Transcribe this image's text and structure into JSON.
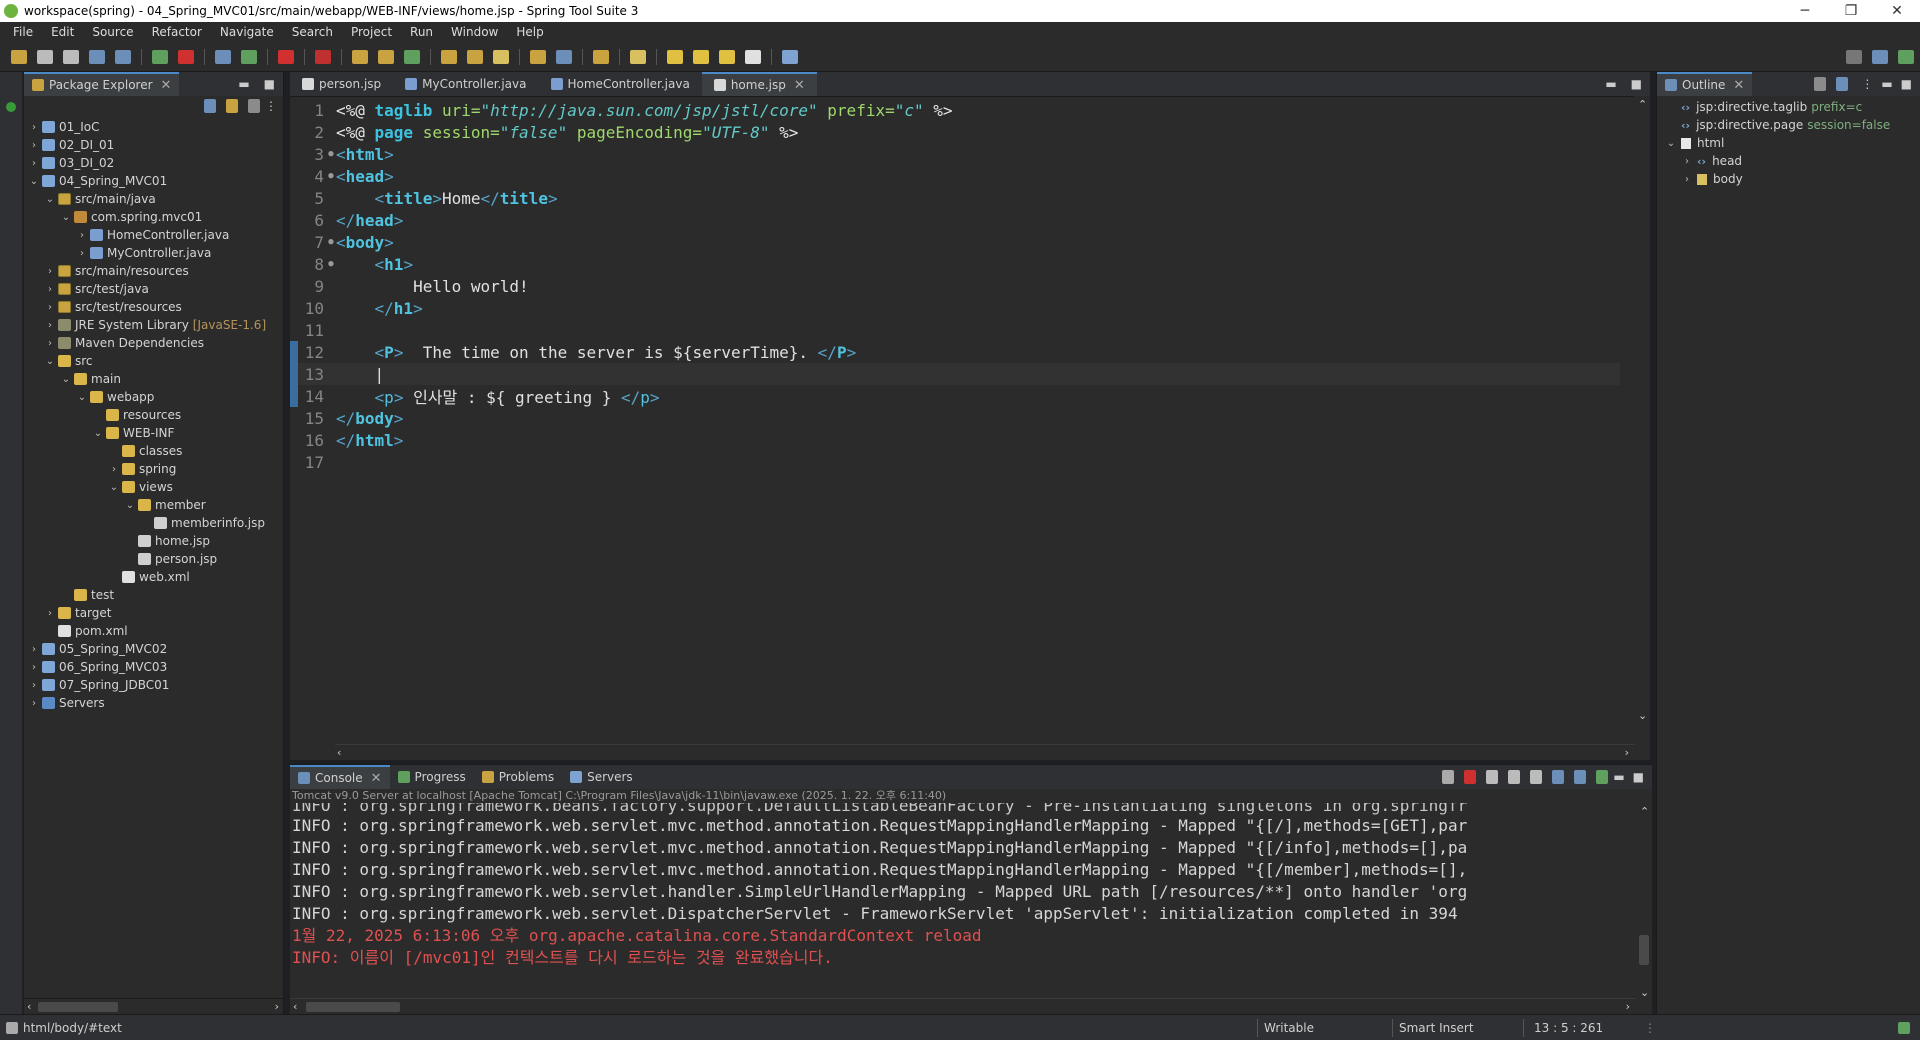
{
  "window": {
    "title": "workspace(spring) - 04_Spring_MVC01/src/main/webapp/WEB-INF/views/home.jsp - Spring Tool Suite 3",
    "minimize": "─",
    "restore": "❐",
    "close": "✕"
  },
  "menu": [
    "File",
    "Edit",
    "Source",
    "Refactor",
    "Navigate",
    "Search",
    "Project",
    "Run",
    "Window",
    "Help"
  ],
  "package_explorer": {
    "title": "Package Explorer",
    "tree": [
      {
        "label": "01_IoC",
        "icon": "project",
        "indent": 0,
        "tw": "›"
      },
      {
        "label": "02_DI_01",
        "icon": "project",
        "indent": 0,
        "tw": "›"
      },
      {
        "label": "03_DI_02",
        "icon": "project",
        "indent": 0,
        "tw": "›"
      },
      {
        "label": "04_Spring_MVC01",
        "icon": "project",
        "indent": 0,
        "tw": "⌄"
      },
      {
        "label": "src/main/java",
        "icon": "srcfolder",
        "indent": 1,
        "tw": "⌄"
      },
      {
        "label": "com.spring.mvc01",
        "icon": "package",
        "indent": 2,
        "tw": "⌄"
      },
      {
        "label": "HomeController.java",
        "icon": "java",
        "indent": 3,
        "tw": "›"
      },
      {
        "label": "MyController.java",
        "icon": "java",
        "indent": 3,
        "tw": "›"
      },
      {
        "label": "src/main/resources",
        "icon": "srcfolder",
        "indent": 1,
        "tw": "›"
      },
      {
        "label": "src/test/java",
        "icon": "srcfolder",
        "indent": 1,
        "tw": "›"
      },
      {
        "label": "src/test/resources",
        "icon": "srcfolder",
        "indent": 1,
        "tw": "›"
      },
      {
        "label": "JRE System Library",
        "icon": "jar",
        "indent": 1,
        "tw": "›",
        "decor": "[JavaSE-1.6]"
      },
      {
        "label": "Maven Dependencies",
        "icon": "jar",
        "indent": 1,
        "tw": "›"
      },
      {
        "label": "src",
        "icon": "folder",
        "indent": 1,
        "tw": "⌄"
      },
      {
        "label": "main",
        "icon": "folder",
        "indent": 2,
        "tw": "⌄"
      },
      {
        "label": "webapp",
        "icon": "folder",
        "indent": 3,
        "tw": "⌄"
      },
      {
        "label": "resources",
        "icon": "folder",
        "indent": 4,
        "tw": ""
      },
      {
        "label": "WEB-INF",
        "icon": "folder",
        "indent": 4,
        "tw": "⌄"
      },
      {
        "label": "classes",
        "icon": "folder",
        "indent": 5,
        "tw": ""
      },
      {
        "label": "spring",
        "icon": "folder",
        "indent": 5,
        "tw": "›"
      },
      {
        "label": "views",
        "icon": "folder",
        "indent": 5,
        "tw": "⌄"
      },
      {
        "label": "member",
        "icon": "folder",
        "indent": 6,
        "tw": "⌄"
      },
      {
        "label": "memberinfo.jsp",
        "icon": "file",
        "indent": 7,
        "tw": ""
      },
      {
        "label": "home.jsp",
        "icon": "file",
        "indent": 6,
        "tw": ""
      },
      {
        "label": "person.jsp",
        "icon": "file",
        "indent": 6,
        "tw": ""
      },
      {
        "label": "web.xml",
        "icon": "xml",
        "indent": 5,
        "tw": ""
      },
      {
        "label": "test",
        "icon": "folder",
        "indent": 2,
        "tw": ""
      },
      {
        "label": "target",
        "icon": "folder",
        "indent": 1,
        "tw": "›"
      },
      {
        "label": "pom.xml",
        "icon": "xml",
        "indent": 1,
        "tw": ""
      },
      {
        "label": "05_Spring_MVC02",
        "icon": "project",
        "indent": 0,
        "tw": "›"
      },
      {
        "label": "06_Spring_MVC03",
        "icon": "project",
        "indent": 0,
        "tw": "›"
      },
      {
        "label": "07_Spring_JDBC01",
        "icon": "project",
        "indent": 0,
        "tw": "›"
      },
      {
        "label": "Servers",
        "icon": "server",
        "indent": 0,
        "tw": "›"
      }
    ]
  },
  "editor": {
    "tabs": [
      {
        "label": "person.jsp",
        "active": false
      },
      {
        "label": "MyController.java",
        "active": false
      },
      {
        "label": "HomeController.java",
        "active": false
      },
      {
        "label": "home.jsp",
        "active": true
      }
    ],
    "current_line": 13,
    "lines": [
      {
        "n": "1",
        "fold": "",
        "tokens": [
          [
            "t-dir",
            "<%@ "
          ],
          [
            "t-kw",
            "taglib"
          ],
          [
            "t-attr",
            " uri="
          ],
          [
            "t-str",
            "\"http://java.sun.com/jsp/jstl/core\""
          ],
          [
            "t-attr",
            " prefix="
          ],
          [
            "t-str",
            "\"c\""
          ],
          [
            "t-dir",
            " %>"
          ]
        ]
      },
      {
        "n": "2",
        "fold": "",
        "tokens": [
          [
            "t-dir",
            "<%@ "
          ],
          [
            "t-kw",
            "page"
          ],
          [
            "t-attr",
            " session="
          ],
          [
            "t-str",
            "\"false\""
          ],
          [
            "t-attr",
            " pageEncoding="
          ],
          [
            "t-str",
            "\"UTF-8\""
          ],
          [
            "t-dir",
            " %>"
          ]
        ]
      },
      {
        "n": "3",
        "fold": "●",
        "tokens": [
          [
            "t-brk",
            "<"
          ],
          [
            "t-tag",
            "html"
          ],
          [
            "t-brk",
            ">"
          ]
        ]
      },
      {
        "n": "4",
        "fold": "●",
        "tokens": [
          [
            "t-brk",
            "<"
          ],
          [
            "t-tag",
            "head"
          ],
          [
            "t-brk",
            ">"
          ]
        ]
      },
      {
        "n": "5",
        "fold": "",
        "tokens": [
          [
            "t-text",
            "    "
          ],
          [
            "t-brk",
            "<"
          ],
          [
            "t-tag",
            "title"
          ],
          [
            "t-brk",
            ">"
          ],
          [
            "t-text",
            "Home"
          ],
          [
            "t-brk",
            "</"
          ],
          [
            "t-tag",
            "title"
          ],
          [
            "t-brk",
            ">"
          ]
        ]
      },
      {
        "n": "6",
        "fold": "",
        "tokens": [
          [
            "t-brk",
            "</"
          ],
          [
            "t-tag",
            "head"
          ],
          [
            "t-brk",
            ">"
          ]
        ]
      },
      {
        "n": "7",
        "fold": "●",
        "tokens": [
          [
            "t-brk",
            "<"
          ],
          [
            "t-tag",
            "body"
          ],
          [
            "t-brk",
            ">"
          ]
        ]
      },
      {
        "n": "8",
        "fold": "●",
        "tokens": [
          [
            "t-text",
            "    "
          ],
          [
            "t-brk",
            "<"
          ],
          [
            "t-tag",
            "h1"
          ],
          [
            "t-brk",
            ">"
          ]
        ]
      },
      {
        "n": "9",
        "fold": "",
        "tokens": [
          [
            "t-text",
            "        Hello world!"
          ]
        ]
      },
      {
        "n": "10",
        "fold": "",
        "tokens": [
          [
            "t-text",
            "    "
          ],
          [
            "t-brk",
            "</"
          ],
          [
            "t-tag",
            "h1"
          ],
          [
            "t-brk",
            ">"
          ]
        ]
      },
      {
        "n": "11",
        "fold": "",
        "tokens": []
      },
      {
        "n": "12",
        "fold": "",
        "tokens": [
          [
            "t-text",
            "    "
          ],
          [
            "t-brk",
            "<"
          ],
          [
            "t-tag",
            "P"
          ],
          [
            "t-brk",
            ">"
          ],
          [
            "t-text",
            "  The time on the server is ${serverTime}. "
          ],
          [
            "t-brk",
            "</"
          ],
          [
            "t-tag",
            "P"
          ],
          [
            "t-brk",
            ">"
          ]
        ]
      },
      {
        "n": "13",
        "fold": "",
        "tokens": [
          [
            "t-text",
            "    |"
          ]
        ]
      },
      {
        "n": "14",
        "fold": "",
        "tokens": [
          [
            "t-text",
            "    "
          ],
          [
            "t-brk",
            "<"
          ],
          [
            "t-tagp",
            "p"
          ],
          [
            "t-brk",
            ">"
          ],
          [
            "t-text",
            " 인사말 : ${ greeting } "
          ],
          [
            "t-brk",
            "</"
          ],
          [
            "t-tagp",
            "p"
          ],
          [
            "t-brk",
            ">"
          ]
        ]
      },
      {
        "n": "15",
        "fold": "",
        "tokens": [
          [
            "t-brk",
            "</"
          ],
          [
            "t-tag",
            "body"
          ],
          [
            "t-brk",
            ">"
          ]
        ]
      },
      {
        "n": "16",
        "fold": "",
        "tokens": [
          [
            "t-brk",
            "</"
          ],
          [
            "t-tag",
            "html"
          ],
          [
            "t-brk",
            ">"
          ]
        ]
      },
      {
        "n": "17",
        "fold": "",
        "tokens": []
      }
    ]
  },
  "outline": {
    "title": "Outline",
    "items": [
      {
        "label": "jsp:directive.taglib",
        "extra": "prefix=c",
        "kind": "dir",
        "indent": 0,
        "tw": ""
      },
      {
        "label": "jsp:directive.page",
        "extra": "session=false",
        "kind": "dir",
        "indent": 0,
        "tw": ""
      },
      {
        "label": "html",
        "extra": "",
        "kind": "el",
        "indent": 0,
        "tw": "⌄"
      },
      {
        "label": "head",
        "extra": "",
        "kind": "dir",
        "indent": 1,
        "tw": "›"
      },
      {
        "label": "body",
        "extra": "",
        "kind": "el2",
        "indent": 1,
        "tw": "›"
      }
    ]
  },
  "console_panel": {
    "tabs": [
      {
        "label": "Console",
        "active": true
      },
      {
        "label": "Progress",
        "active": false
      },
      {
        "label": "Problems",
        "active": false
      },
      {
        "label": "Servers",
        "active": false
      }
    ],
    "process": "Tomcat v9.0 Server at localhost [Apache Tomcat] C:\\Program Files\\Java\\jdk-11\\bin\\javaw.exe  (2025. 1. 22. 오후 6:11:40)",
    "cut_line": "INFO : org.springframework.beans.factory.support.DefaultListableBeanFactory - Pre-instantiating singletons in org.springfr",
    "lines": [
      {
        "text": "INFO : org.springframework.web.servlet.mvc.method.annotation.RequestMappingHandlerMapping - Mapped \"{[/],methods=[GET],par",
        "kind": "info"
      },
      {
        "text": "INFO : org.springframework.web.servlet.mvc.method.annotation.RequestMappingHandlerMapping - Mapped \"{[/info],methods=[],pa",
        "kind": "info"
      },
      {
        "text": "INFO : org.springframework.web.servlet.mvc.method.annotation.RequestMappingHandlerMapping - Mapped \"{[/member],methods=[],",
        "kind": "info"
      },
      {
        "text": "INFO : org.springframework.web.servlet.handler.SimpleUrlHandlerMapping - Mapped URL path [/resources/**] onto handler 'org",
        "kind": "info"
      },
      {
        "text": "INFO : org.springframework.web.servlet.DispatcherServlet - FrameworkServlet 'appServlet': initialization completed in 394",
        "kind": "info"
      },
      {
        "text": "1월 22, 2025 6:13:06 오후 org.apache.catalina.core.StandardContext reload",
        "kind": "red"
      },
      {
        "text": "INFO: 이름이 [/mvc01]인 컨텍스트를 다시 로드하는 것을 완료했습니다.",
        "kind": "red"
      }
    ]
  },
  "status": {
    "path": "html/body/#text",
    "writable": "Writable",
    "insert_mode": "Smart Insert",
    "position": "13 : 5 : 261"
  }
}
